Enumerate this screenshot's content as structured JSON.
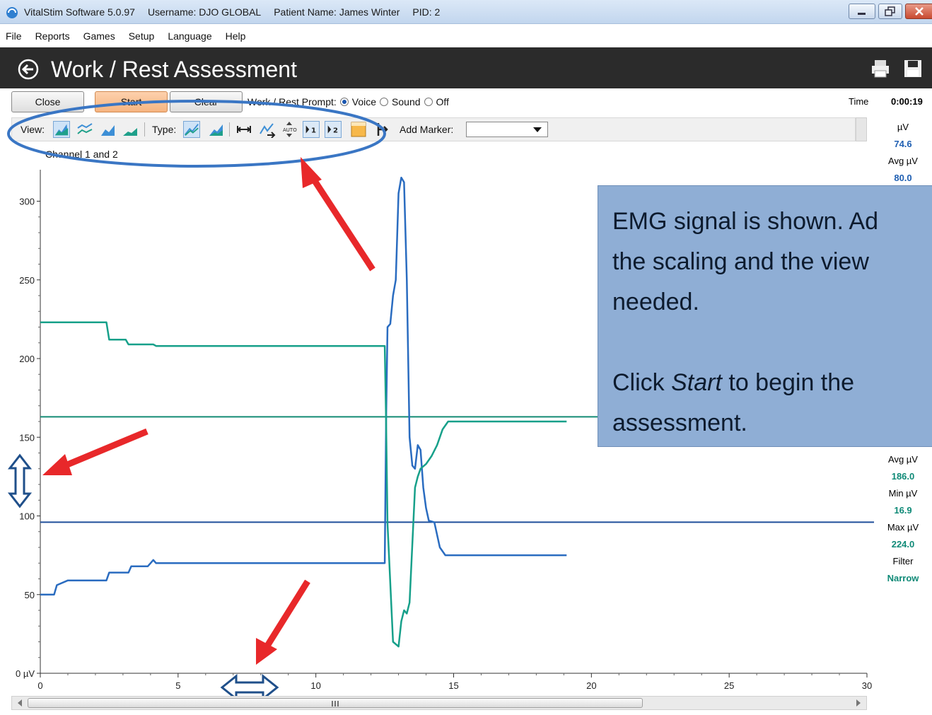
{
  "window": {
    "app_name": "VitalStim Software 5.0.97",
    "username": "Username: DJO GLOBAL",
    "patient": "Patient Name: James Winter",
    "pid": "PID: 2"
  },
  "menu": [
    "File",
    "Reports",
    "Games",
    "Setup",
    "Language",
    "Help"
  ],
  "page_title": "Work / Rest Assessment",
  "buttons": {
    "close": "Close",
    "start": "Start",
    "clear": "Clear"
  },
  "prompt": {
    "label": "Work / Rest Prompt:",
    "options": [
      "Voice",
      "Sound",
      "Off"
    ],
    "selected": "Voice"
  },
  "toolbar": {
    "view_label": "View:",
    "type_label": "Type:",
    "add_marker_label": "Add Marker:"
  },
  "channel_label": "Channel 1 and 2",
  "side_panel": {
    "time_label": "Time",
    "time_value": "0:00:19",
    "uv_label": "µV",
    "uv_value": "74.6",
    "avg_label": "Avg µV",
    "avg_value": "80.0",
    "ch2_avg_label": "Avg µV",
    "ch2_avg_value": "186.0",
    "ch2_min_label": "Min µV",
    "ch2_min_value": "16.9",
    "ch2_max_label": "Max µV",
    "ch2_max_value": "224.0",
    "filter_label": "Filter",
    "filter_value": "Narrow"
  },
  "callout": {
    "line1": "EMG signal is shown. Ad",
    "line2": "the scaling and the view",
    "line3": "needed.",
    "line4_pre": "Click ",
    "line4_em": "Start",
    "line4_post": " to begin the",
    "line5": "assessment."
  },
  "colors": {
    "ch1": "#2a6cc0",
    "ch2": "#17a08a",
    "threshold1": "#1f4f9a",
    "threshold2": "#138a74",
    "arrow": "#e8282a"
  },
  "chart_data": {
    "type": "line",
    "xlim": [
      0,
      30
    ],
    "ylim": [
      0,
      320
    ],
    "x_ticks": [
      0,
      5,
      10,
      15,
      20,
      25,
      30
    ],
    "y_ticks": [
      0,
      50,
      100,
      150,
      200,
      250,
      300
    ],
    "y_tick_labels": [
      "0 µV",
      "50",
      "100",
      "150",
      "200",
      "250",
      "300"
    ],
    "thresholds": [
      {
        "series": "ch2",
        "y": 163
      },
      {
        "series": "ch1",
        "y": 96
      }
    ],
    "series": [
      {
        "id": "ch1",
        "x": [
          0,
          0.5,
          0.6,
          1.0,
          2.4,
          2.5,
          3.2,
          3.3,
          3.9,
          4.0,
          4.1,
          4.2,
          12.5,
          12.55,
          12.6,
          12.7,
          12.8,
          12.9,
          13.0,
          13.1,
          13.2,
          13.3,
          13.4,
          13.5,
          13.6,
          13.7,
          13.8,
          13.9,
          14.0,
          14.1,
          14.3,
          14.5,
          14.7,
          15,
          19.1
        ],
        "y": [
          50,
          50,
          56,
          59,
          59,
          64,
          64,
          68,
          68,
          70,
          72,
          70,
          70,
          160,
          220,
          222,
          240,
          250,
          305,
          315,
          312,
          250,
          150,
          132,
          130,
          145,
          142,
          118,
          105,
          97,
          96,
          80,
          75,
          75,
          75
        ]
      },
      {
        "id": "ch2",
        "x": [
          0,
          2.4,
          2.5,
          3.1,
          3.2,
          4.1,
          4.2,
          12.5,
          12.55,
          12.6,
          12.8,
          13.0,
          13.1,
          13.2,
          13.3,
          13.4,
          13.6,
          13.7,
          13.8,
          14.0,
          14.2,
          14.4,
          14.6,
          14.8,
          15.0,
          19.1
        ],
        "y": [
          223,
          223,
          212,
          212,
          209,
          209,
          208,
          208,
          160,
          95,
          20,
          17,
          33,
          40,
          38,
          45,
          118,
          125,
          130,
          133,
          138,
          145,
          155,
          160,
          160,
          160
        ]
      }
    ]
  }
}
